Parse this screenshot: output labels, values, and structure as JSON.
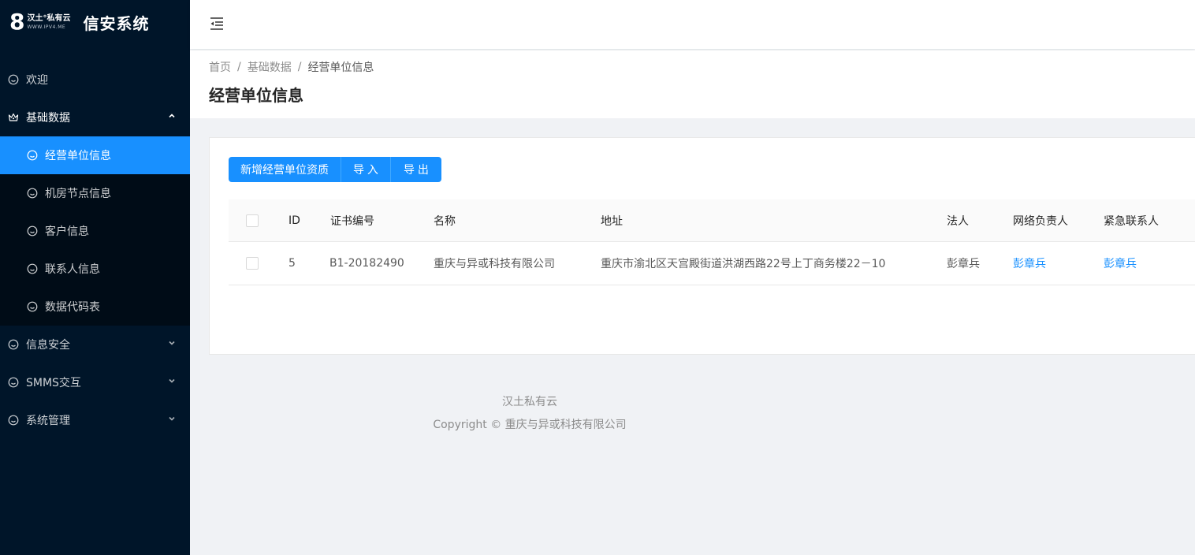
{
  "logo": {
    "mark": "8",
    "brand_cn": "汉土°私有云",
    "brand_url": "WWW.IPV4.ME",
    "app_title": "信安系统"
  },
  "sidebar": {
    "items": [
      {
        "label": "欢迎",
        "icon": "smile-icon"
      },
      {
        "label": "基础数据",
        "icon": "crown-icon",
        "expanded": true,
        "children": [
          {
            "label": "经营单位信息",
            "active": true
          },
          {
            "label": "机房节点信息"
          },
          {
            "label": "客户信息"
          },
          {
            "label": "联系人信息"
          },
          {
            "label": "数据代码表"
          }
        ]
      },
      {
        "label": "信息安全",
        "icon": "smile-icon"
      },
      {
        "label": "SMMS交互",
        "icon": "smile-icon"
      },
      {
        "label": "系统管理",
        "icon": "smile-icon"
      }
    ]
  },
  "breadcrumb": [
    "首页",
    "基础数据",
    "经营单位信息"
  ],
  "breadcrumb_sep": "/",
  "page_title": "经营单位信息",
  "toolbar": {
    "add_label": "新增经营单位资质",
    "import_label": "导 入",
    "export_label": "导 出"
  },
  "table": {
    "columns": [
      "ID",
      "证书编号",
      "名称",
      "地址",
      "法人",
      "网络负责人",
      "紧急联系人"
    ],
    "rows": [
      {
        "id": "5",
        "cert_no": "B1-20182490",
        "name": "重庆与异或科技有限公司",
        "address": "重庆市渝北区天宫殿街道洪湖西路22号上丁商务楼22－10",
        "legal": "彭章兵",
        "net_manager": "彭章兵",
        "emergency": "彭章兵"
      }
    ]
  },
  "footer": {
    "line1": "汉土私有云",
    "line2": "Copyright © 重庆与异或科技有限公司"
  },
  "colors": {
    "sidebar_bg": "#001529",
    "submenu_bg": "#000c17",
    "primary": "#1890ff"
  }
}
